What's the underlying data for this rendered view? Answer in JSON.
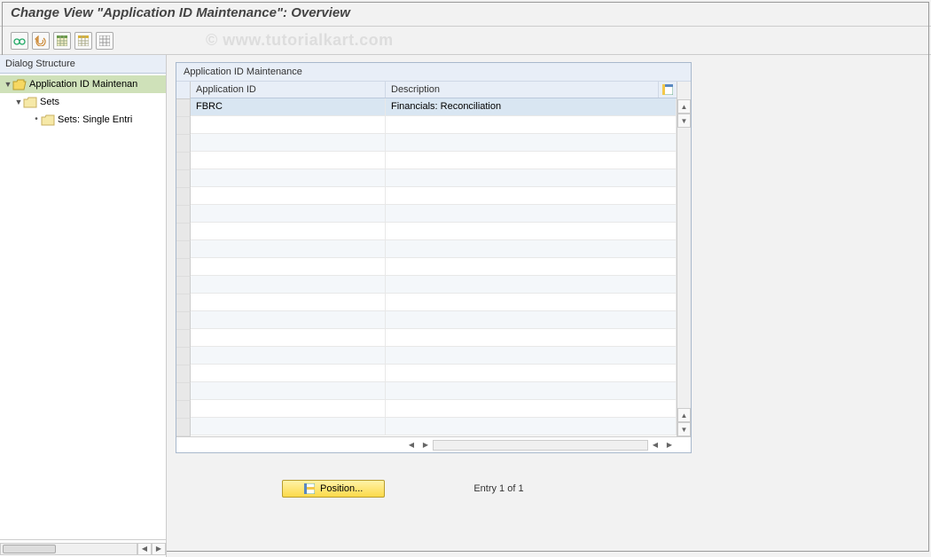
{
  "title": "Change View \"Application ID Maintenance\": Overview",
  "watermark": "© www.tutorialkart.com",
  "toolbar": {
    "other_view": "other-view",
    "undo": "undo",
    "select_all": "select-all",
    "save": "save",
    "deselect": "deselect"
  },
  "left_panel": {
    "header": "Dialog Structure",
    "tree": {
      "root": {
        "label": "Application ID Maintenan",
        "expanded": true
      },
      "sets": {
        "label": "Sets",
        "expanded": true
      },
      "single": {
        "label": "Sets: Single Entri"
      }
    }
  },
  "panel": {
    "title": "Application ID Maintenance",
    "columns": {
      "c1": "Application ID",
      "c2": "Description"
    },
    "rows": [
      {
        "id": "FBRC",
        "desc": "Financials: Reconciliation"
      }
    ]
  },
  "footer": {
    "position_label": "Position...",
    "entry_text": "Entry 1 of 1"
  }
}
